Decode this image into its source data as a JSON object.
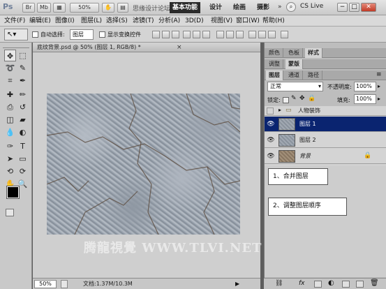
{
  "app": {
    "logo": "Ps",
    "title_overlay": "思缘设计论坛"
  },
  "titlebar": {
    "btn_br": "Br",
    "btn_mb": "Mb",
    "zoom": "50%",
    "workspaces": [
      "基本功能",
      "设计",
      "绘画",
      "摄影"
    ],
    "cs_live": "CS Live"
  },
  "menu": [
    "文件(F)",
    "编辑(E)",
    "图像(I)",
    "图层(L)",
    "选择(S)",
    "滤镜(T)",
    "分析(A)",
    "3D(D)",
    "视图(V)",
    "窗口(W)",
    "帮助(H)"
  ],
  "options": {
    "auto_select_label": "自动选择:",
    "auto_select_value": "图层",
    "show_transform_label": "显示变换控件"
  },
  "document": {
    "tab_title": "底纹背景.psd @ 50% (图层 1, RGB/8) *",
    "zoom": "50%",
    "doc_info": "文档:1.37M/10.3M"
  },
  "panel": {
    "top_tabs": [
      "颜色",
      "色板",
      "样式"
    ],
    "adjust_tabs": [
      "调整",
      "蒙版"
    ],
    "layer_tabs": [
      "图层",
      "通道",
      "路径"
    ],
    "blend_mode": "正常",
    "opacity_label": "不透明度:",
    "opacity_value": "100%",
    "lock_label": "锁定:",
    "fill_label": "填充:",
    "fill_value": "100%",
    "layers": [
      {
        "name": "人物装饰",
        "type": "group"
      },
      {
        "name": "图层 1",
        "selected": true
      },
      {
        "name": "图层 2"
      },
      {
        "name": "背景",
        "locked": true
      }
    ]
  },
  "callouts": [
    "1、合并图层",
    "2、调整图层顺序"
  ],
  "watermark": "腾龍視覺 WWW.TLVI.NET",
  "colors": {
    "selected_layer": "#0a2470",
    "panel_bg": "#bdbdbd",
    "canvas_bg": "#cfcfcf"
  }
}
